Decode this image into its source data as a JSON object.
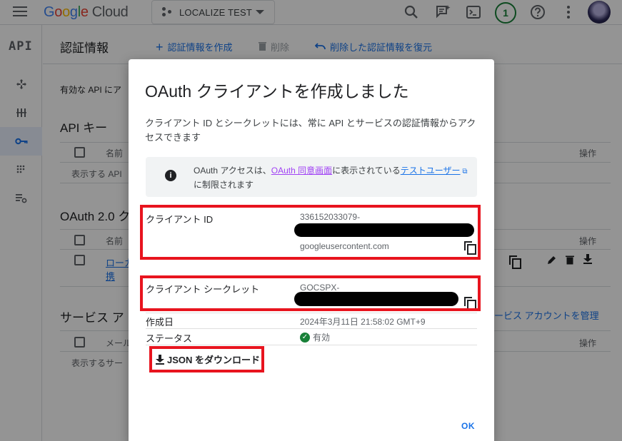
{
  "topbar": {
    "logo_google": [
      "G",
      "o",
      "o",
      "g",
      "l",
      "e"
    ],
    "logo_cloud": "Cloud",
    "project_name": "LOCALIZE TEST",
    "notification_count": "1"
  },
  "rail": {
    "api_label": "API"
  },
  "header": {
    "title": "認証情報",
    "create_label": "認証情報を作成",
    "delete_label": "削除",
    "restore_label": "削除した認証情報を復元"
  },
  "background": {
    "enabled_text": "有効な API にア",
    "api_keys_title": "API キー",
    "col_name": "名前",
    "col_action": "操作",
    "api_keys_empty": "表示する API",
    "oauth_title": "OAuth 2.0 ク",
    "oauth_row_name_1": "ローカ",
    "oauth_row_name_2": "携",
    "service_title": "サービス ア",
    "manage_service": "ービス アカウントを管理",
    "col_email": "メール",
    "service_empty": "表示するサー"
  },
  "dialog": {
    "title": "OAuth クライアントを作成しました",
    "description": "クライアント ID とシークレットには、常に API とサービスの認証情報からアクセスできます",
    "info_prefix": "OAuth アクセスは、",
    "info_link1": "OAuth 同意画面",
    "info_mid": "に表示されている",
    "info_link2": "テストユーザー",
    "info_suffix": "に制限されます",
    "client_id_label": "クライアント ID",
    "client_id_value_1": "336152033079-",
    "client_id_value_2": "googleusercontent.com",
    "client_secret_label": "クライアント シークレット",
    "client_secret_value": "GOCSPX-",
    "created_label": "作成日",
    "created_value": "2024年3月11日 21:58:02 GMT+9",
    "status_label": "ステータス",
    "status_value": "有効",
    "download_label": "JSON をダウンロード",
    "ok_label": "OK"
  },
  "colors": {
    "accent": "#1a73e8",
    "highlight_red": "#e8141e",
    "status_green": "#188038"
  }
}
